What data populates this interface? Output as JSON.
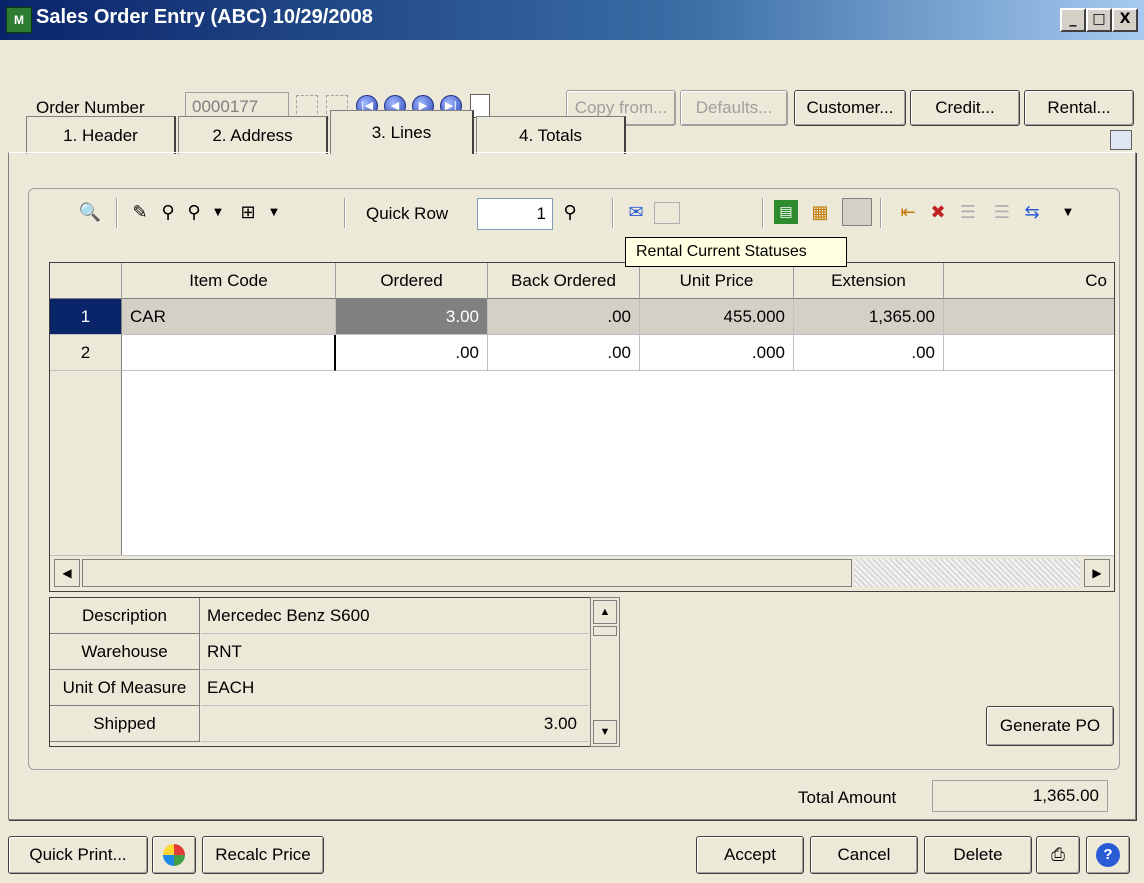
{
  "window": {
    "title": "Sales Order Entry (ABC) 10/29/2008",
    "icon": "app-icon",
    "min_label": "_",
    "max_label": "□",
    "close_label": "X"
  },
  "order": {
    "label": "Order Number",
    "value": "0000177"
  },
  "top_buttons": {
    "copy_from": "Copy from...",
    "defaults": "Defaults...",
    "customer": "Customer...",
    "credit": "Credit...",
    "rental": "Rental..."
  },
  "tabs": [
    {
      "label": "1. Header"
    },
    {
      "label": "2. Address"
    },
    {
      "label": "3. Lines"
    },
    {
      "label": "4. Totals"
    }
  ],
  "toolbar": {
    "quick_row_label": "Quick Row",
    "quick_row_value": "1",
    "tooltip": "Rental Current Statuses"
  },
  "grid": {
    "columns": [
      "Item Code",
      "Ordered",
      "Back Ordered",
      "Unit Price",
      "Extension",
      "Co"
    ],
    "rows": [
      {
        "num": "1",
        "item_code": "CAR",
        "ordered": "3.00",
        "back_ordered": ".00",
        "unit_price": "455.000",
        "extension": "1,365.00"
      },
      {
        "num": "2",
        "item_code": "",
        "ordered": ".00",
        "back_ordered": ".00",
        "unit_price": ".000",
        "extension": ".00"
      }
    ]
  },
  "details": {
    "description_label": "Description",
    "description_value": "Mercedec Benz S600",
    "warehouse_label": "Warehouse",
    "warehouse_value": "RNT",
    "uom_label": "Unit Of Measure",
    "uom_value": "EACH",
    "shipped_label": "Shipped",
    "shipped_value": "3.00"
  },
  "generate_po": "Generate PO",
  "totals": {
    "label": "Total Amount",
    "value": "1,365.00"
  },
  "bottom_buttons": {
    "quick_print": "Quick Print...",
    "recalc_price": "Recalc Price",
    "accept": "Accept",
    "cancel": "Cancel",
    "delete": "Delete"
  },
  "colors": {
    "title_bar": "#0a246a",
    "selected_row": "#0a246a",
    "tooltip_bg": "#ffffe1"
  }
}
